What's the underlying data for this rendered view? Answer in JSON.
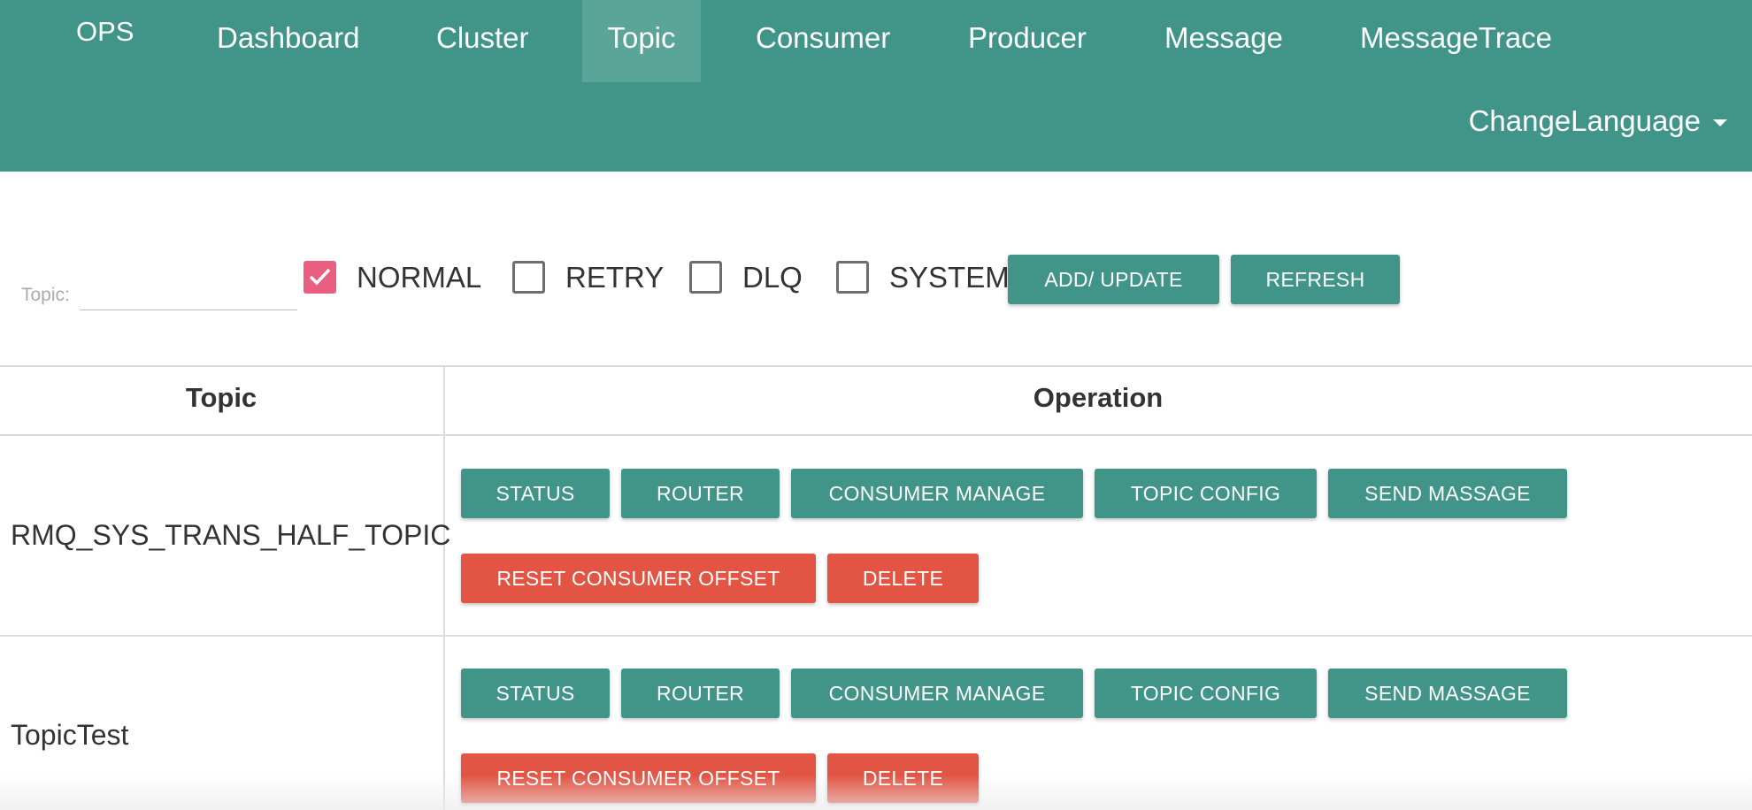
{
  "nav": {
    "brand": "OPS",
    "items": [
      {
        "label": "Dashboard"
      },
      {
        "label": "Cluster"
      },
      {
        "label": "Topic",
        "active": true
      },
      {
        "label": "Consumer"
      },
      {
        "label": "Producer"
      },
      {
        "label": "Message"
      },
      {
        "label": "MessageTrace"
      }
    ],
    "change_language": "ChangeLanguage"
  },
  "filter": {
    "topic_label": "Topic:",
    "topic_value": "",
    "checkboxes": [
      {
        "label": "NORMAL",
        "checked": true
      },
      {
        "label": "RETRY",
        "checked": false
      },
      {
        "label": "DLQ",
        "checked": false
      },
      {
        "label": "SYSTEM",
        "checked": false
      }
    ],
    "add_update_label": "ADD/ UPDATE",
    "refresh_label": "REFRESH"
  },
  "table": {
    "headers": [
      "Topic",
      "Operation"
    ],
    "operations": {
      "status": "STATUS",
      "router": "ROUTER",
      "consumer_manage": "CONSUMER MANAGE",
      "topic_config": "TOPIC CONFIG",
      "send_message": "SEND MASSAGE",
      "reset_offset": "RESET CONSUMER OFFSET",
      "delete": "DELETE"
    },
    "rows": [
      {
        "topic": "RMQ_SYS_TRANS_HALF_TOPIC"
      },
      {
        "topic": "TopicTest"
      }
    ]
  },
  "colors": {
    "primary": "#419588",
    "danger": "#e25443",
    "checkbox_checked": "#e85f82"
  }
}
